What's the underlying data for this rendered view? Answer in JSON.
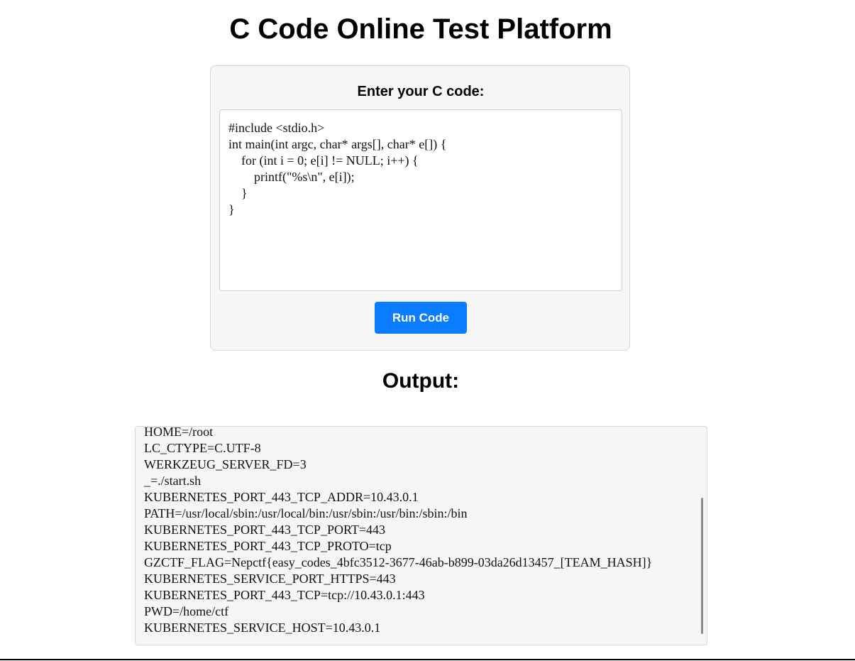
{
  "header": {
    "title": "C Code Online Test Platform"
  },
  "editor": {
    "label": "Enter your C code:",
    "code": "#include <stdio.h>\nint main(int argc, char* args[], char* e[]) {\n    for (int i = 0; e[i] != NULL; i++) {\n        printf(\"%s\\n\", e[i]);\n    }\n}",
    "run_label": "Run Code"
  },
  "output": {
    "heading": "Output:",
    "lines": [
      "HOME=/root",
      "LC_CTYPE=C.UTF-8",
      "WERKZEUG_SERVER_FD=3",
      "_=./start.sh",
      "KUBERNETES_PORT_443_TCP_ADDR=10.43.0.1",
      "PATH=/usr/local/sbin:/usr/local/bin:/usr/sbin:/usr/bin:/sbin:/bin",
      "KUBERNETES_PORT_443_TCP_PORT=443",
      "KUBERNETES_PORT_443_TCP_PROTO=tcp",
      "GZCTF_FLAG=Nepctf{easy_codes_4bfc3512-3677-46ab-b899-03da26d13457_[TEAM_HASH]}",
      "KUBERNETES_SERVICE_PORT_HTTPS=443",
      "KUBERNETES_PORT_443_TCP=tcp://10.43.0.1:443",
      "PWD=/home/ctf",
      "KUBERNETES_SERVICE_HOST=10.43.0.1"
    ]
  },
  "colors": {
    "accent": "#0a7cff",
    "panel": "#f6f6f6"
  }
}
